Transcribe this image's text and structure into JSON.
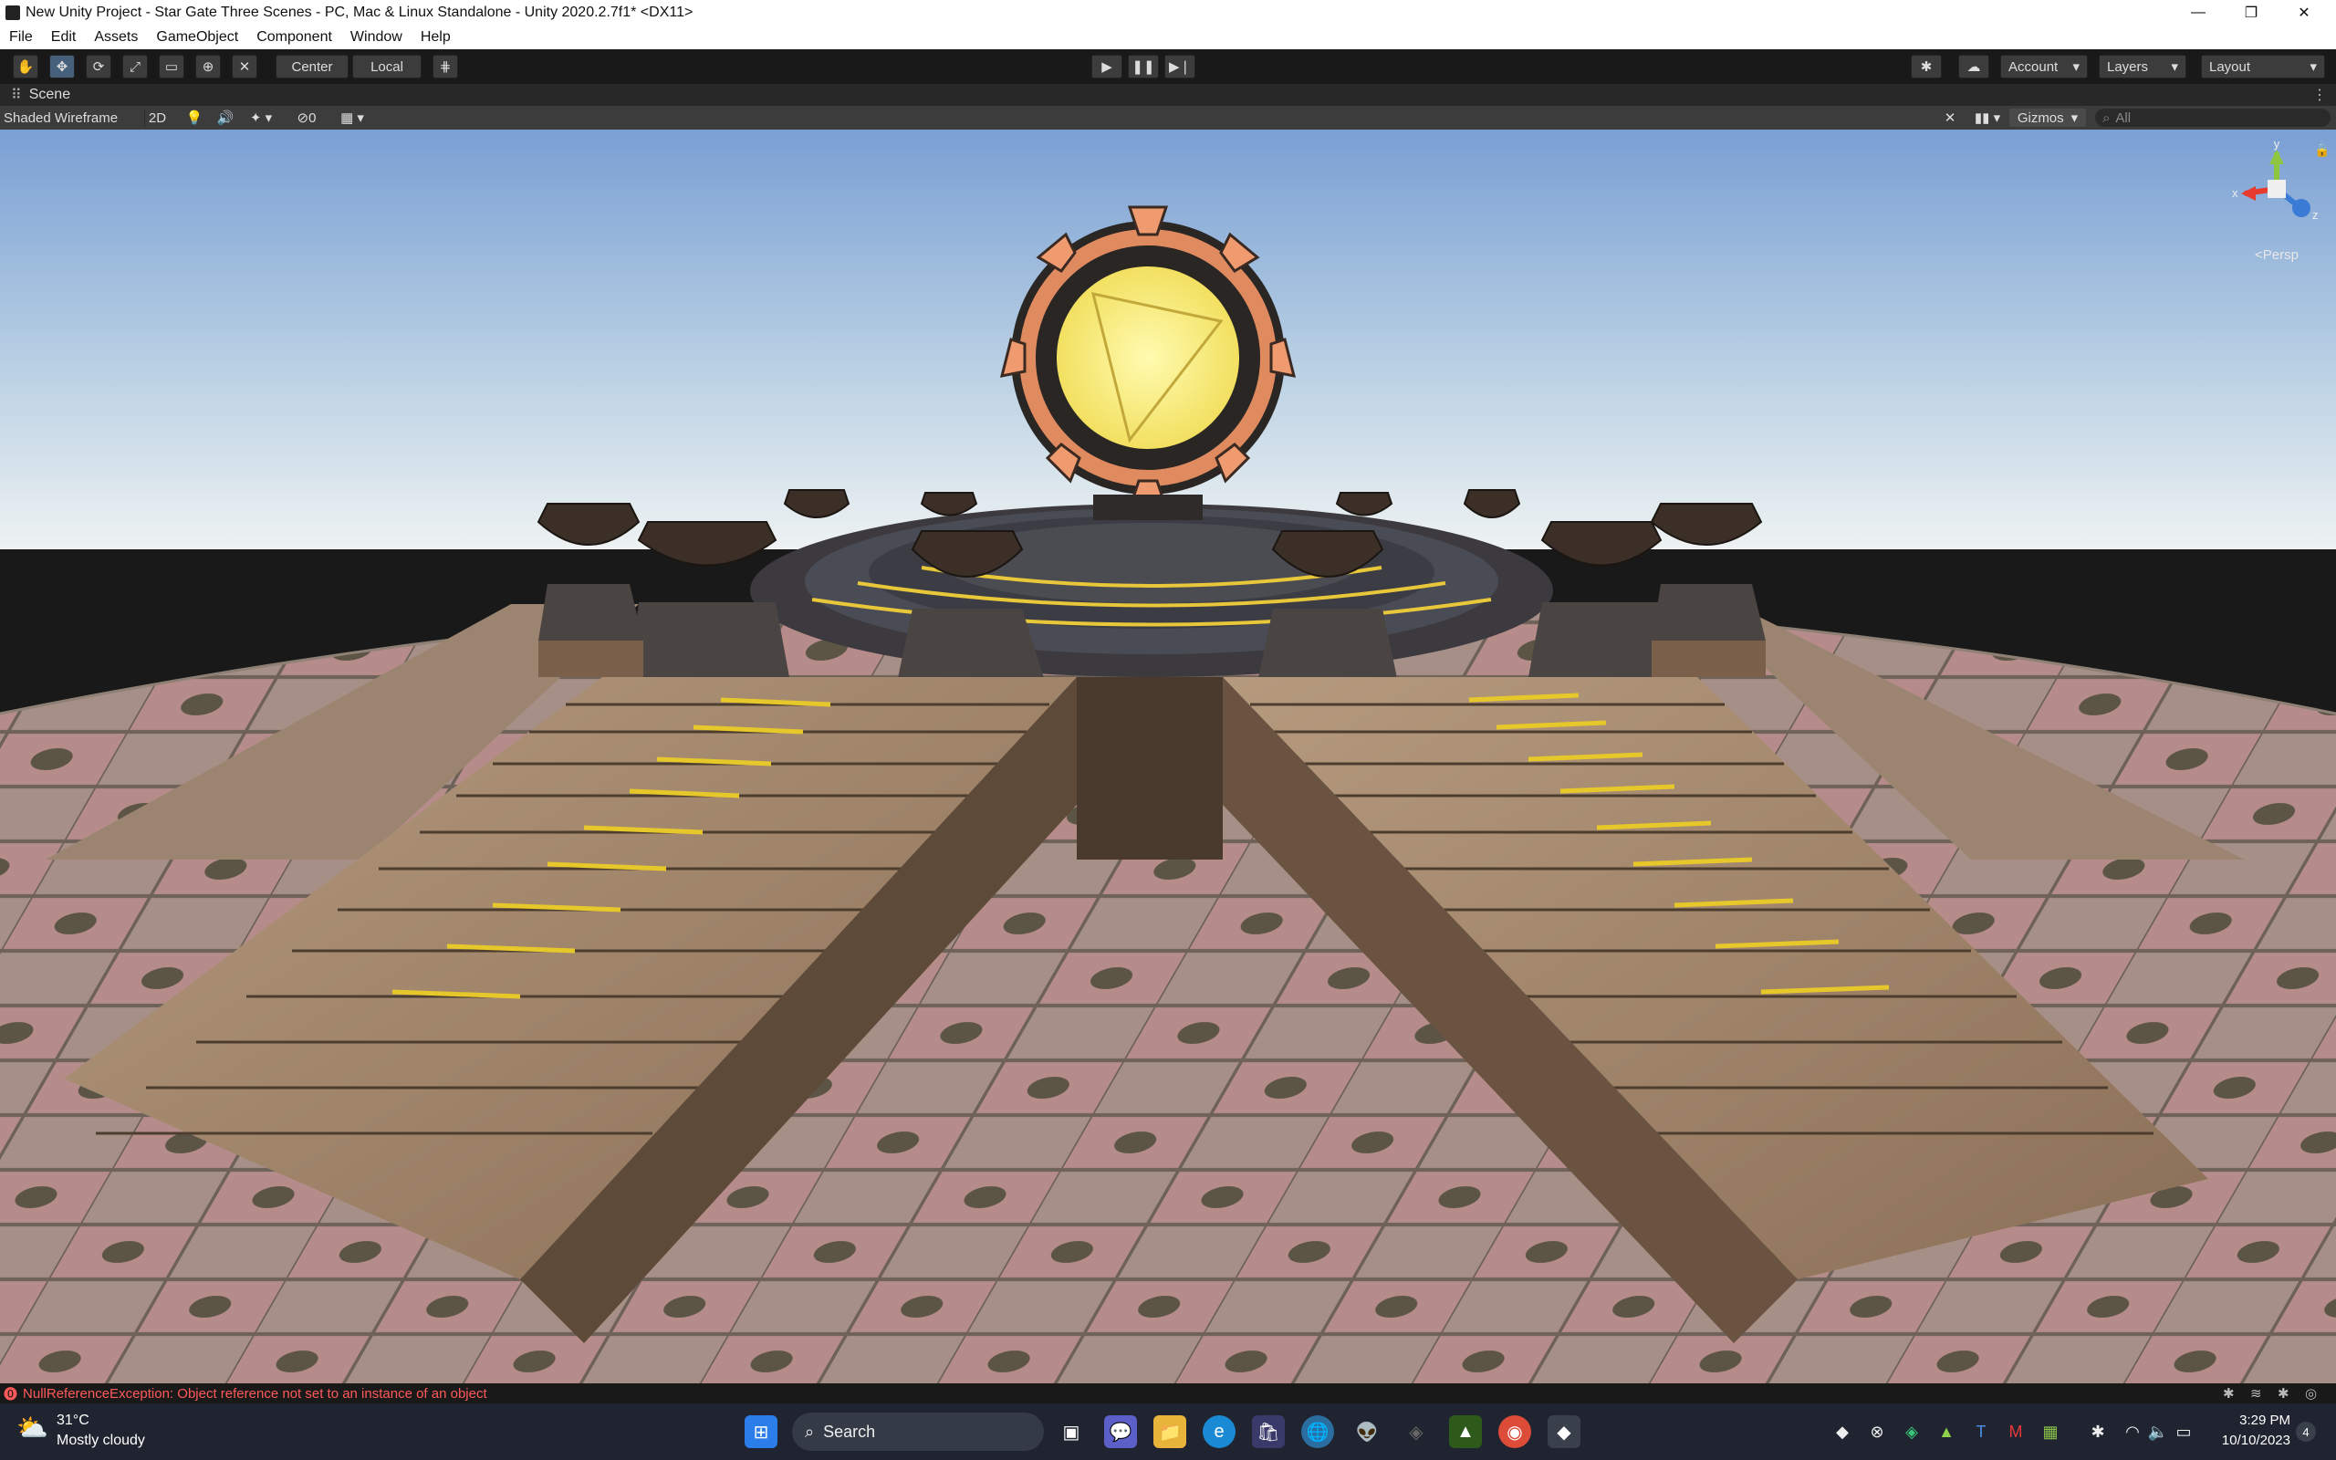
{
  "window": {
    "title": "New Unity Project - Star Gate Three Scenes - PC, Mac & Linux Standalone - Unity 2020.2.7f1* <DX11>",
    "minimize": "—",
    "maximize": "❐",
    "close": "✕"
  },
  "menu": [
    "File",
    "Edit",
    "Assets",
    "GameObject",
    "Component",
    "Window",
    "Help"
  ],
  "toolbar": {
    "pivot": "Center",
    "space": "Local",
    "account": "Account",
    "layers": "Layers",
    "layout": "Layout"
  },
  "scene_tab": {
    "label": "Scene"
  },
  "scene_bar": {
    "draw_mode": "Shaded Wireframe",
    "mode_2d": "2D",
    "hidden_count": "0",
    "gizmos": "Gizmos",
    "search_placeholder": "All"
  },
  "gizmo": {
    "y": "y",
    "x": "x",
    "z": "z",
    "projection": "<Persp"
  },
  "status": {
    "message": "NullReferenceException: Object reference not set to an instance of an object"
  },
  "taskbar": {
    "weather_temp": "31°C",
    "weather_desc": "Mostly cloudy",
    "search": "Search",
    "time": "3:29 PM",
    "date": "10/10/2023",
    "notifications": "4"
  },
  "colors": {
    "editor_dark": "#191919",
    "panel": "#3c3c3c",
    "sky_top": "#7a9fd4",
    "floor": "#a89988",
    "stairs": "#8a7058",
    "portal_glow": "#f8f07a",
    "portal_ring": "#e08a60",
    "error": "#ff5a5a"
  }
}
